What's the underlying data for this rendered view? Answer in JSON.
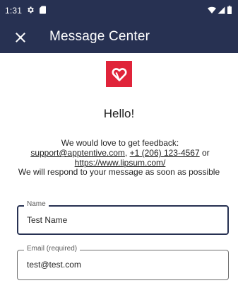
{
  "status_bar": {
    "time": "1:31",
    "icons": [
      "settings-gear-icon",
      "sd-card-icon",
      "wifi-icon",
      "cell-signal-icon",
      "battery-icon"
    ]
  },
  "app_bar": {
    "title": "Message Center",
    "close_icon": "close-icon",
    "background": "#273152"
  },
  "logo": {
    "icon": "heart-logo-icon",
    "color": "#e0243a"
  },
  "greeting": "Hello!",
  "feedback": {
    "prefix": "We would love to get feedback: ",
    "email_link": "support@apptentive.com",
    "separator": ", ",
    "phone_link": "+1 (206) 123-4567",
    "or_text": " or ",
    "url_link": "https://www.lipsum.com/"
  },
  "respond_text": "We will respond to your message as soon as possible",
  "form": {
    "name_field": {
      "label": "Name",
      "value": "Test Name"
    },
    "email_field": {
      "label": "Email (required)",
      "value": "test@test.com"
    }
  }
}
